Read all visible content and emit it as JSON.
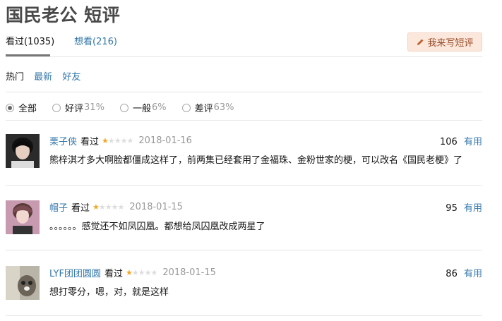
{
  "title": "国民老公 短评",
  "tabs": {
    "watched": "看过(1035)",
    "wish": "想看(216)"
  },
  "write_button": "我来写短评",
  "sort": {
    "hot": "热门",
    "latest": "最新",
    "friends": "好友"
  },
  "filters": [
    {
      "label": "全部",
      "pct": "",
      "checked": true
    },
    {
      "label": "好评",
      "pct": "31%",
      "checked": false
    },
    {
      "label": "一般",
      "pct": "6%",
      "checked": false
    },
    {
      "label": "差评",
      "pct": "63%",
      "checked": false
    }
  ],
  "comments": [
    {
      "user": "栗子侠",
      "status": "看过",
      "rating": 1,
      "max_rating": 5,
      "date": "2018-01-16",
      "votes": "106",
      "vote_label": "有用",
      "text": "熊梓淇才多大啊脸都僵成这样了，前两集已经套用了金福珠、金粉世家的梗，可以改名《国民老梗》了"
    },
    {
      "user": "帽子",
      "status": "看过",
      "rating": 1,
      "max_rating": 5,
      "date": "2018-01-15",
      "votes": "95",
      "vote_label": "有用",
      "text": "。。。。。。感觉还不如凤囚凰。都想给凤囚凰改成两星了"
    },
    {
      "user": "LYF团团圆圆",
      "status": "看过",
      "rating": 1,
      "max_rating": 5,
      "date": "2018-01-15",
      "votes": "86",
      "vote_label": "有用",
      "text": "想打零分，嗯，对，就是这样"
    }
  ],
  "colors": {
    "link": "#3377aa",
    "star": "#f5a623",
    "write_button_bg": "#fbe7dc"
  }
}
